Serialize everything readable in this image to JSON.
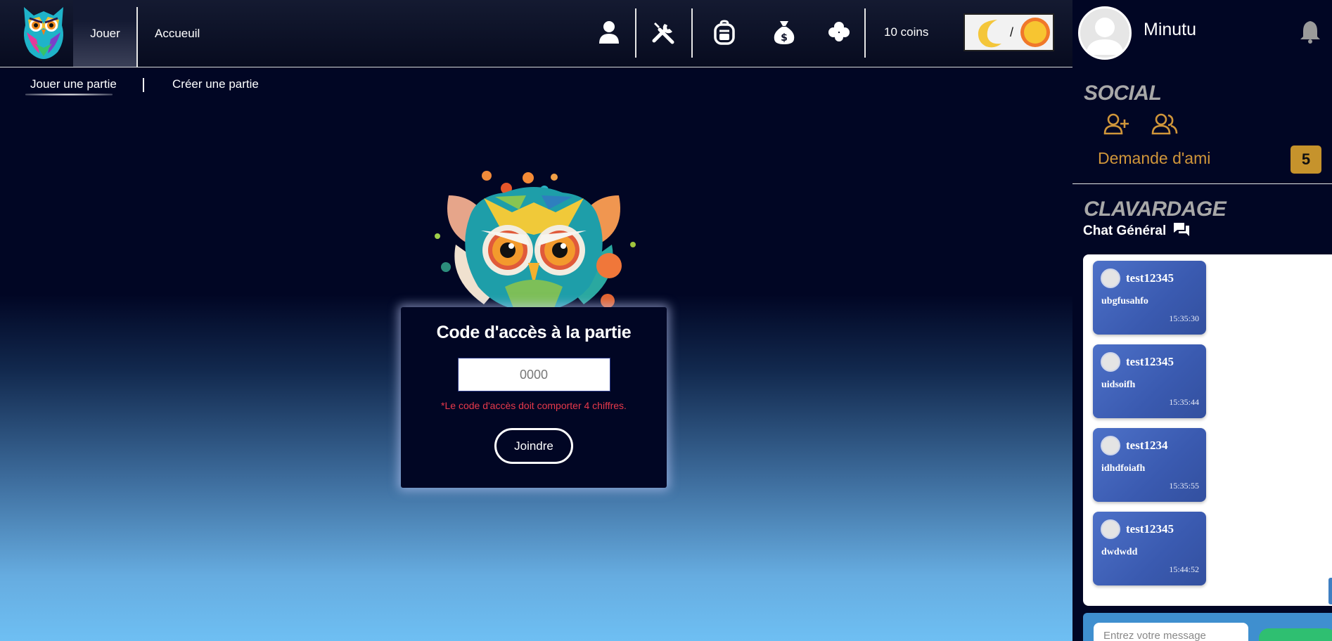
{
  "header": {
    "tabs": [
      {
        "label": "Jouer",
        "active": true
      },
      {
        "label": "Accueuil",
        "active": false
      }
    ],
    "icons": [
      "user-icon",
      "tools-icon",
      "backpack-icon",
      "money-bag-icon",
      "clover-icon"
    ],
    "coins_label": "10 coins",
    "theme_toggle": {
      "separator": "/",
      "left": "moon-icon",
      "right": "sun-icon"
    }
  },
  "subtabs": [
    {
      "label": "Jouer une partie",
      "active": true
    },
    {
      "label": "Créer une partie",
      "active": false
    }
  ],
  "join_card": {
    "title": "Code d'accès à la partie",
    "input_placeholder": "0000",
    "input_value": "",
    "error": "*Le code d'accès doit comporter 4 chiffres.",
    "button_label": "Joindre"
  },
  "profile": {
    "username": "Minutu"
  },
  "social": {
    "title": "SOCIAL",
    "friend_requests_label": "Demande d'ami",
    "friend_requests_count": "5"
  },
  "chat": {
    "section_title": "CLAVARDAGE",
    "channel": "Chat Général",
    "messages": [
      {
        "user": "test12345",
        "text": "ubgfusahfo",
        "time": "15:35:30"
      },
      {
        "user": "test12345",
        "text": "uidsoifh",
        "time": "15:35:44"
      },
      {
        "user": "test1234",
        "text": "idhdfoiafh",
        "time": "15:35:55"
      },
      {
        "user": "test12345",
        "text": "dwdwdd",
        "time": "15:44:52"
      }
    ],
    "input_placeholder": "Entrez votre message"
  },
  "colors": {
    "accent_gold": "#c6932c",
    "error_red": "#e8394b",
    "background": "#010624",
    "message_blue": "#4d71c8"
  }
}
